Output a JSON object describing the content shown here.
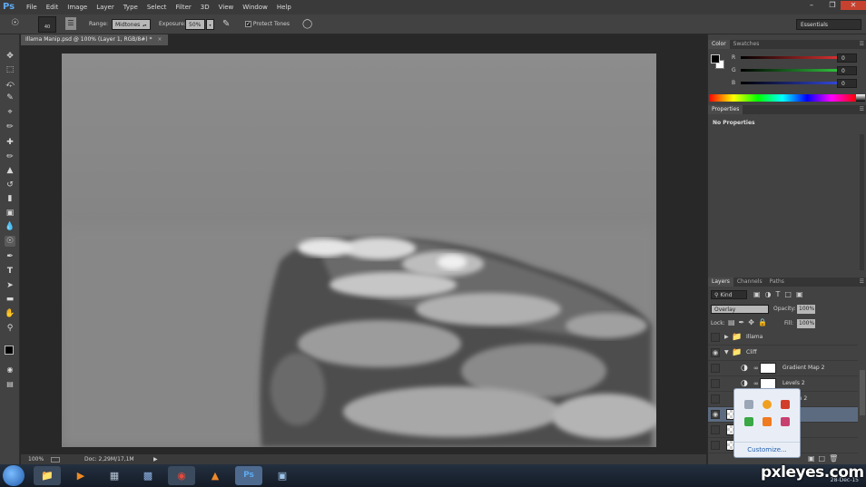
{
  "app": {
    "logo": "Ps"
  },
  "menu": [
    "File",
    "Edit",
    "Image",
    "Layer",
    "Type",
    "Select",
    "Filter",
    "3D",
    "View",
    "Window",
    "Help"
  ],
  "window_controls": {
    "minimize": "–",
    "restore": "❐",
    "close": "✕"
  },
  "options": {
    "brush_size": "40",
    "range_label": "Range:",
    "range_value": "Midtones",
    "exposure_label": "Exposure:",
    "exposure_value": "50%",
    "protect_tones_checked": true,
    "protect_tones_label": "Protect Tones",
    "workspace": "Essentials"
  },
  "document": {
    "tab_title": "Illama Manip.psd @ 100% (Layer 1, RGB/8#) *",
    "tab_close": "×"
  },
  "status": {
    "zoom": "100%",
    "doc_info": "Doc: 2,29M/17,1M"
  },
  "color_panel": {
    "tabs": [
      "Color",
      "Swatches"
    ],
    "active_tab": "Color",
    "channels": [
      {
        "label": "R",
        "value": "0",
        "color": "#d43030"
      },
      {
        "label": "G",
        "value": "0",
        "color": "#2fbf3c"
      },
      {
        "label": "B",
        "value": "0",
        "color": "#3346d8"
      }
    ]
  },
  "properties_panel": {
    "tabs": [
      "Properties"
    ],
    "message": "No Properties"
  },
  "layers_panel": {
    "tabs": [
      "Layers",
      "Channels",
      "Paths"
    ],
    "active_tab": "Layers",
    "filter_kind": "Kind",
    "blend_mode": "Overlay",
    "opacity_label": "Opacity:",
    "opacity_value": "100%",
    "lock_label": "Lock:",
    "fill_label": "Fill:",
    "fill_value": "100%",
    "layers": [
      {
        "name": "Illama",
        "visible": false,
        "type": "group",
        "expanded": false,
        "selected": false
      },
      {
        "name": "Cliff",
        "visible": true,
        "type": "group",
        "expanded": true,
        "selected": false
      },
      {
        "name": "Gradient Map 2",
        "visible": false,
        "type": "adjustment",
        "selected": false
      },
      {
        "name": "Levels 2",
        "visible": false,
        "type": "adjustment",
        "selected": false
      },
      {
        "name": "uration 2",
        "visible": false,
        "type": "adjustment",
        "selected": false
      },
      {
        "name": "",
        "visible": true,
        "type": "pixel",
        "selected": true
      },
      {
        "name": "",
        "visible": false,
        "type": "pixel",
        "selected": false
      },
      {
        "name": "",
        "visible": false,
        "type": "pixel",
        "selected": false
      }
    ]
  },
  "tray_popup": {
    "customize": "Customize..."
  },
  "taskbar": {
    "date": "28-Dec-15"
  },
  "watermark": "pxleyes.com"
}
